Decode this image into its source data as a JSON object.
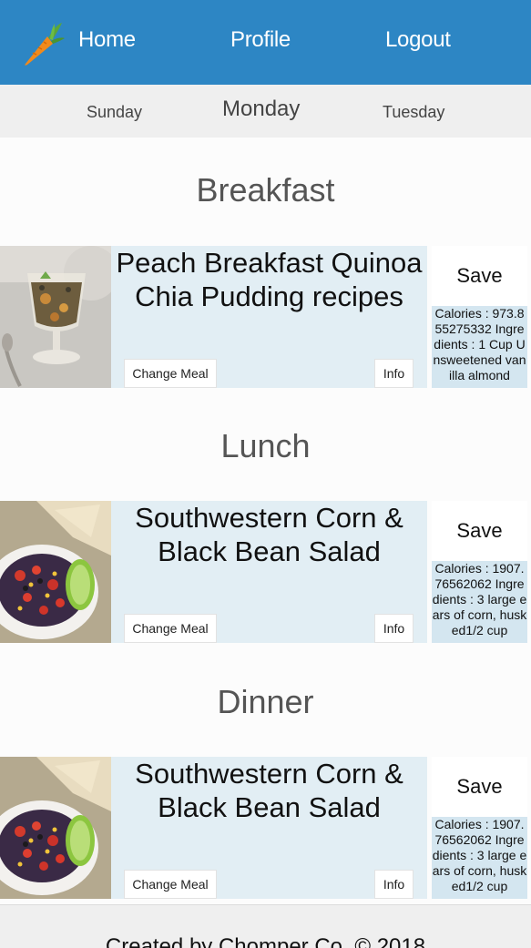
{
  "nav": {
    "home": "Home",
    "profile": "Profile",
    "logout": "Logout"
  },
  "days": {
    "prev": "Sunday",
    "current": "Monday",
    "next": "Tuesday"
  },
  "meals": [
    {
      "section": "Breakfast",
      "title": "Peach Breakfast Quinoa Chia Pudding recipes",
      "change_label": "Change Meal",
      "info_label": "Info",
      "save_label": "Save",
      "details": "Calories : 973.855275332 Ingredients : 1 Cup Unsweetened vanilla almond"
    },
    {
      "section": "Lunch",
      "title": "Southwestern Corn & Black Bean Salad",
      "change_label": "Change Meal",
      "info_label": "Info",
      "save_label": "Save",
      "details": "Calories : 1907.76562062 Ingredients : 3 large ears of corn, husked1/2 cup"
    },
    {
      "section": "Dinner",
      "title": "Southwestern Corn & Black Bean Salad",
      "change_label": "Change Meal",
      "info_label": "Info",
      "save_label": "Save",
      "details": "Calories : 1907.76562062 Ingredients : 3 large ears of corn, husked1/2 cup"
    }
  ],
  "footer": {
    "text": "Created by Chomper Co. © 2018"
  },
  "colors": {
    "nav_bg": "#2d86c4",
    "day_bar_bg": "#efefef",
    "card_bg": "#e2eef4",
    "info_bg": "#d4e6f0"
  }
}
